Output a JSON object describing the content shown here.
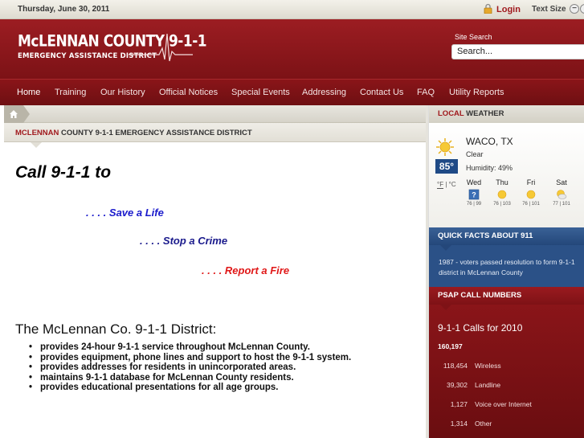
{
  "topbar": {
    "date": "Thursday, June 30, 2011",
    "login": "Login",
    "text_size": "Text Size"
  },
  "header": {
    "logo_line1": "McLENNAN COUNTY 9-1-1",
    "logo_line2": "EMERGENCY ASSISTANCE DISTRICT",
    "search_label": "Site Search",
    "search_value": "Search..."
  },
  "nav": {
    "items": [
      "Home",
      "Training",
      "Our History",
      "Official Notices",
      "Special Events",
      "Addressing",
      "Contact Us",
      "FAQ",
      "Utility Reports"
    ]
  },
  "page_heading": {
    "highlight": "MCLENNAN",
    "rest": " COUNTY 9-1-1 EMERGENCY ASSISTANCE DISTRICT"
  },
  "main": {
    "call_title": "Call 9-1-1 to",
    "phrase1": ". . . . Save a Life",
    "phrase2": ". . . . Stop a Crime",
    "phrase3": ". . . . Report a Fire",
    "district_title": "The McLennan Co. 9-1-1 District:",
    "bullets": [
      "provides 24-hour 9-1-1 service throughout McLennan County.",
      "provides equipment, phone lines and support to host the 9-1-1 system.",
      "provides addresses for residents in unincorporated areas.",
      "maintains 9-1-1 database for McLennan County residents.",
      "provides educational presentations for all age groups."
    ]
  },
  "weather": {
    "head_highlight": "LOCAL",
    "head_rest": " WEATHER",
    "city": "WACO, TX",
    "condition": "Clear",
    "temp": "85°",
    "humidity": "Humidity: 49%",
    "unit_f": "°F",
    "unit_sep": " | ",
    "unit_c": "°C",
    "forecast": [
      {
        "day": "Wed",
        "range": "76 | 99",
        "icon": "storm-icon"
      },
      {
        "day": "Thu",
        "range": "76 | 103",
        "icon": "sun-icon"
      },
      {
        "day": "Fri",
        "range": "76 | 101",
        "icon": "sun-icon"
      },
      {
        "day": "Sat",
        "range": "77 | 101",
        "icon": "partly-cloudy-icon"
      }
    ]
  },
  "facts": {
    "head": "QUICK FACTS ABOUT 911",
    "line1": "1987 - voters passed resolution to form 9-1-1",
    "line2": "district in McLennan County"
  },
  "psap": {
    "head": "PSAP CALL NUMBERS",
    "title": "9-1-1 Calls for 2010",
    "total": "160,197",
    "rows": [
      {
        "num": "118,454",
        "label": "Wireless"
      },
      {
        "num": "39,302",
        "label": "Landline"
      },
      {
        "num": "1,127",
        "label": "Voice over Internet"
      },
      {
        "num": "1,314",
        "label": "Other"
      }
    ]
  },
  "colors": {
    "brand_red": "#8a1519",
    "accent_blue": "#2b5187",
    "link_red": "#a0191d"
  }
}
